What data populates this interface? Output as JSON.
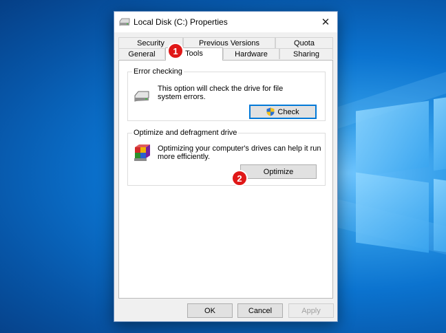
{
  "window": {
    "title": "Local Disk (C:) Properties",
    "close_glyph": "✕"
  },
  "tabs_top": [
    "Security",
    "Previous Versions",
    "Quota"
  ],
  "tabs_bottom": [
    "General",
    "Tools",
    "Hardware",
    "Sharing"
  ],
  "active_tab": "Tools",
  "error_checking": {
    "heading": "Error checking",
    "desc_line1": "This option will check the drive for file",
    "desc_line2": "system errors.",
    "button": "Check"
  },
  "optimize": {
    "heading": "Optimize and defragment drive",
    "desc_line1": "Optimizing your computer's drives can help it run",
    "desc_line2": "more efficiently.",
    "button": "Optimize"
  },
  "footer": {
    "ok": "OK",
    "cancel": "Cancel",
    "apply": "Apply"
  },
  "badges": {
    "one": "1",
    "two": "2"
  },
  "colors": {
    "accent": "#0078d7",
    "badge": "#e01818",
    "desktop": "#0b73cf"
  }
}
